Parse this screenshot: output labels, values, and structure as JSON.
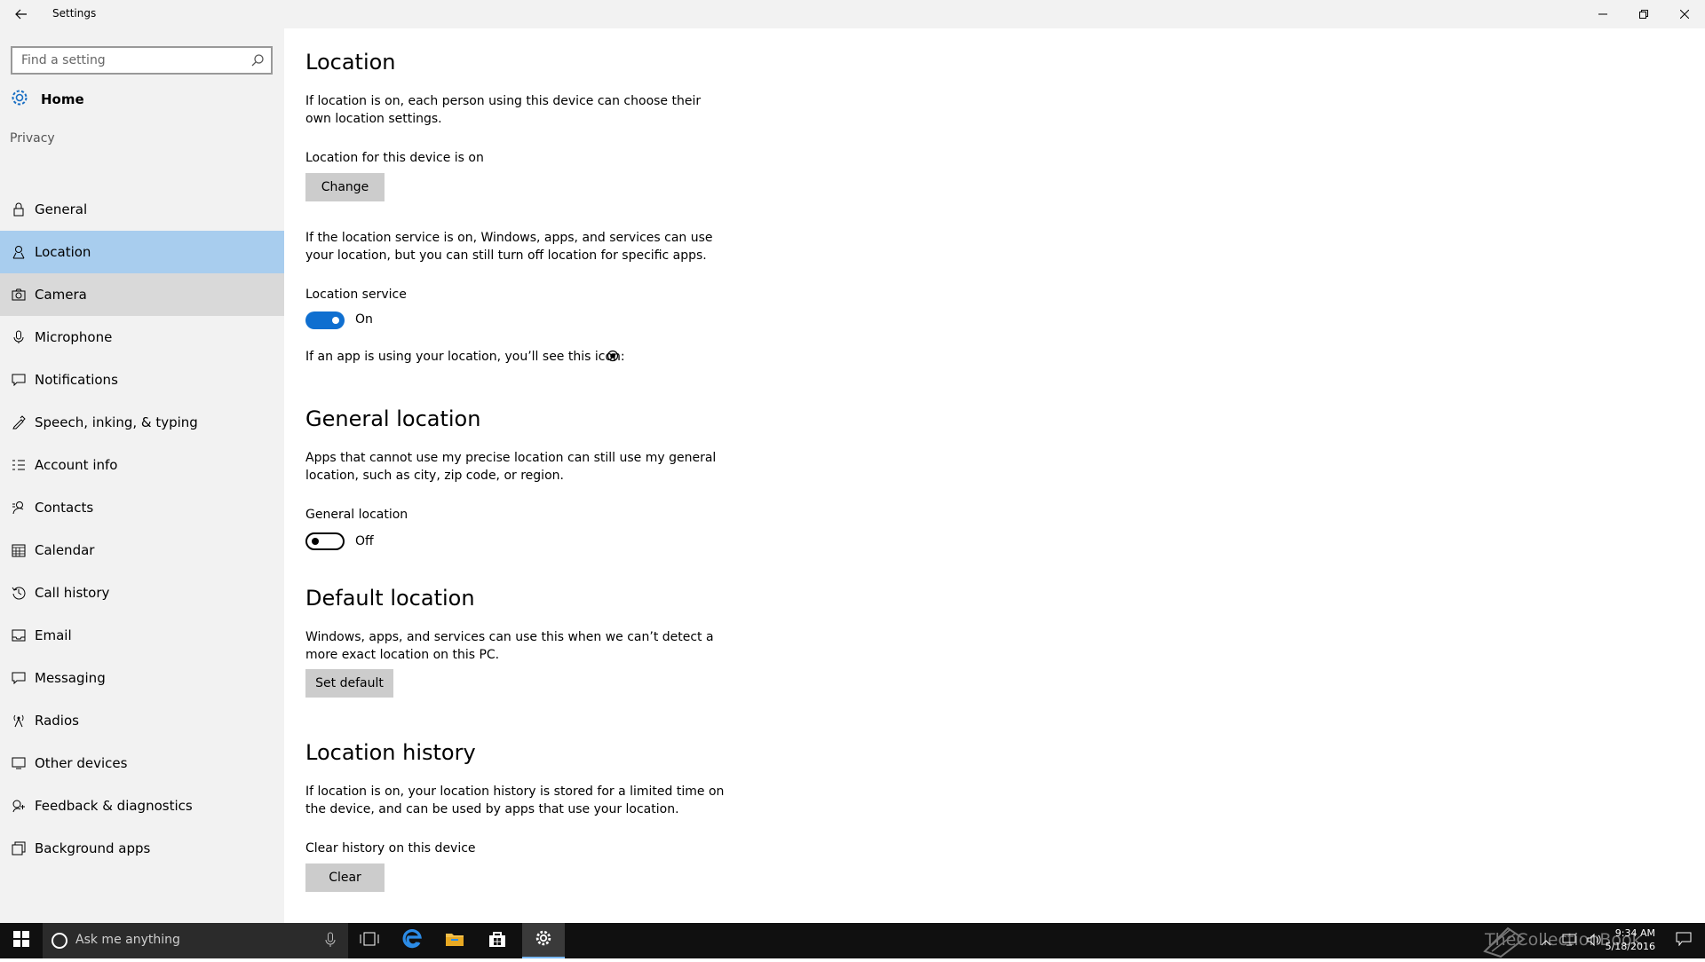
{
  "window": {
    "title": "Settings"
  },
  "sidebar": {
    "search_placeholder": "Find a setting",
    "home_label": "Home",
    "group_label": "Privacy",
    "items": [
      {
        "label": "General",
        "icon": "lock-icon"
      },
      {
        "label": "Location",
        "icon": "location-pin-icon",
        "selected": true
      },
      {
        "label": "Camera",
        "icon": "camera-icon"
      },
      {
        "label": "Microphone",
        "icon": "microphone-icon"
      },
      {
        "label": "Notifications",
        "icon": "notification-icon"
      },
      {
        "label": "Speech, inking, & typing",
        "icon": "pen-icon"
      },
      {
        "label": "Account info",
        "icon": "account-info-icon"
      },
      {
        "label": "Contacts",
        "icon": "contacts-icon"
      },
      {
        "label": "Calendar",
        "icon": "calendar-icon"
      },
      {
        "label": "Call history",
        "icon": "history-icon"
      },
      {
        "label": "Email",
        "icon": "email-icon"
      },
      {
        "label": "Messaging",
        "icon": "message-icon"
      },
      {
        "label": "Radios",
        "icon": "radio-tower-icon"
      },
      {
        "label": "Other devices",
        "icon": "devices-icon"
      },
      {
        "label": "Feedback & diagnostics",
        "icon": "feedback-icon"
      },
      {
        "label": "Background apps",
        "icon": "background-apps-icon"
      }
    ]
  },
  "content": {
    "location": {
      "heading": "Location",
      "desc_line1": "If location is on, each person using this device can choose their",
      "desc_line2": "own location settings.",
      "device_status": "Location for this device is on",
      "change_button": "Change",
      "service_desc_line1": "If the location service is on, Windows, apps, and services can use",
      "service_desc_line2": "your location, but you can still turn off location for specific apps.",
      "service_label": "Location service",
      "service_state": "On",
      "icon_note": "If an app is using your location, you’ll see this icon:"
    },
    "general_location": {
      "heading": "General location",
      "desc_line1": "Apps that cannot use my precise location can still use my general",
      "desc_line2": "location, such as city, zip code, or region.",
      "toggle_label": "General location",
      "toggle_state": "Off"
    },
    "default_location": {
      "heading": "Default location",
      "desc_line1": "Windows, apps, and services can use this when we can’t detect a",
      "desc_line2": "more exact location on this PC.",
      "button": "Set default"
    },
    "location_history": {
      "heading": "Location history",
      "desc_line1": "If location is on, your location history is stored for a limited time on",
      "desc_line2": "the device, and can be used by apps that use your location.",
      "clear_label": "Clear history on this device",
      "clear_button": "Clear"
    }
  },
  "taskbar": {
    "search_placeholder": "Ask me anything",
    "time": "9:34 AM",
    "date": "5/18/2016",
    "watermark": "TheCollectionBook"
  },
  "colors": {
    "accent": "#0f6fd0",
    "selected": "#a8cdee",
    "sidebar": "#f2f2f2"
  }
}
